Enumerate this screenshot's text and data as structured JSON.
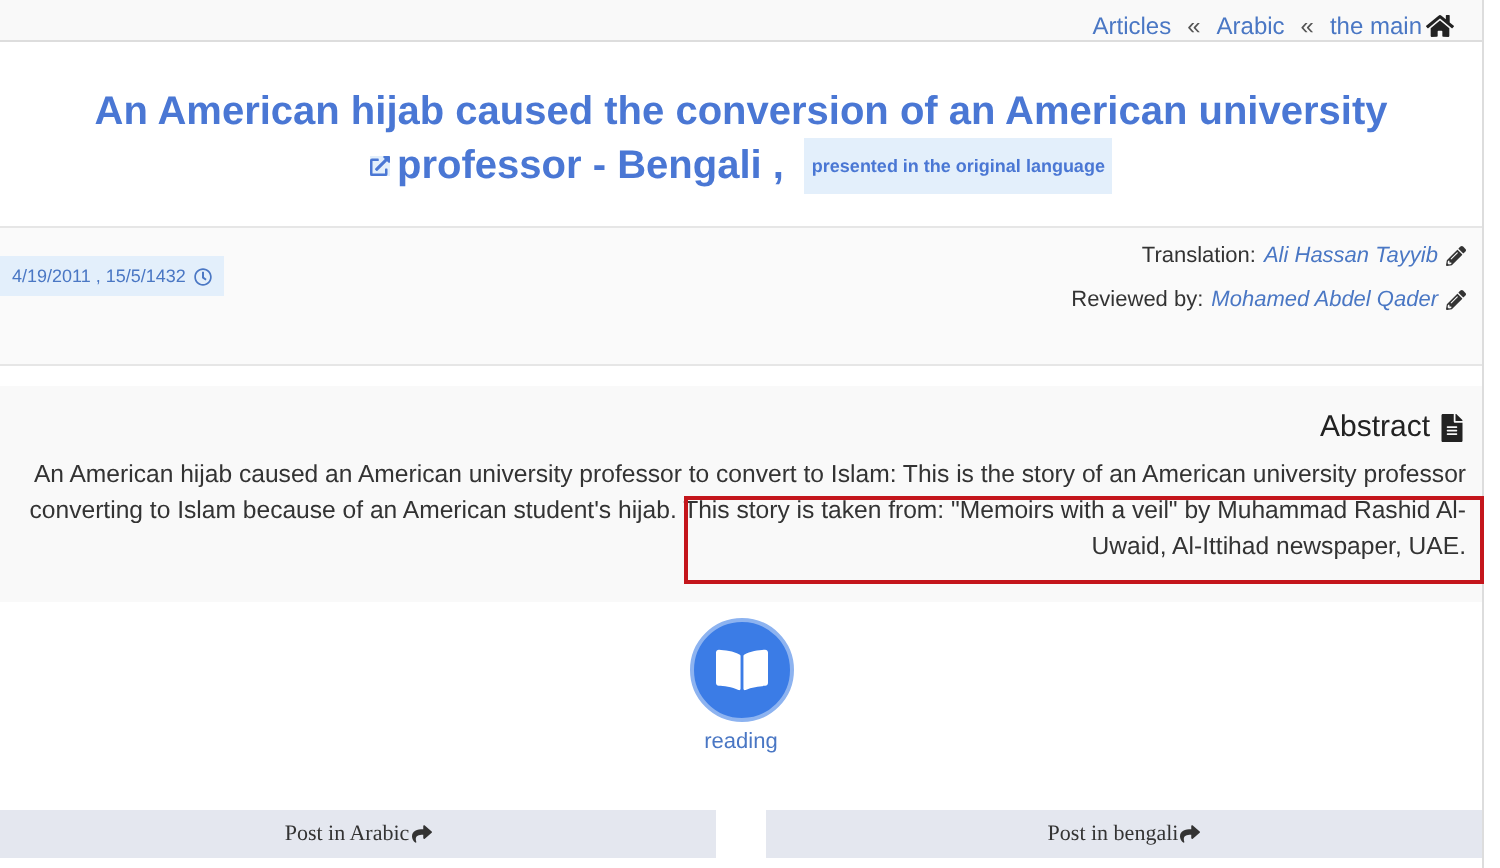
{
  "breadcrumb": [
    {
      "label": "Articles"
    },
    {
      "label": "Arabic"
    },
    {
      "label": "the main"
    }
  ],
  "breadcrumb_separator": "«",
  "title": {
    "lines": [
      "An American hijab caused the conversion of an American university",
      "professor - Bengali ,"
    ],
    "badge": "presented in the original language"
  },
  "date": "4/19/2011 , 15/5/1432",
  "credits": [
    {
      "label": "Translation:",
      "name": "Ali Hassan Tayyib"
    },
    {
      "label": "Reviewed by:",
      "name": "Mohamed Abdel Qader"
    }
  ],
  "abstract": {
    "heading": "Abstract",
    "text": "An American hijab caused an American university professor to convert to Islam: This is the story of an American university professor converting to Islam because of an American student's hijab. This story is taken from: \"Memoirs with a veil\" by Muhammad Rashid Al-Uwaid, Al-Ittihad newspaper, UAE.",
    "highlight_box": true
  },
  "reading": {
    "label": "reading"
  },
  "posts": [
    {
      "label": "Post in Arabic"
    },
    {
      "label": "Post in bengali"
    }
  ]
}
